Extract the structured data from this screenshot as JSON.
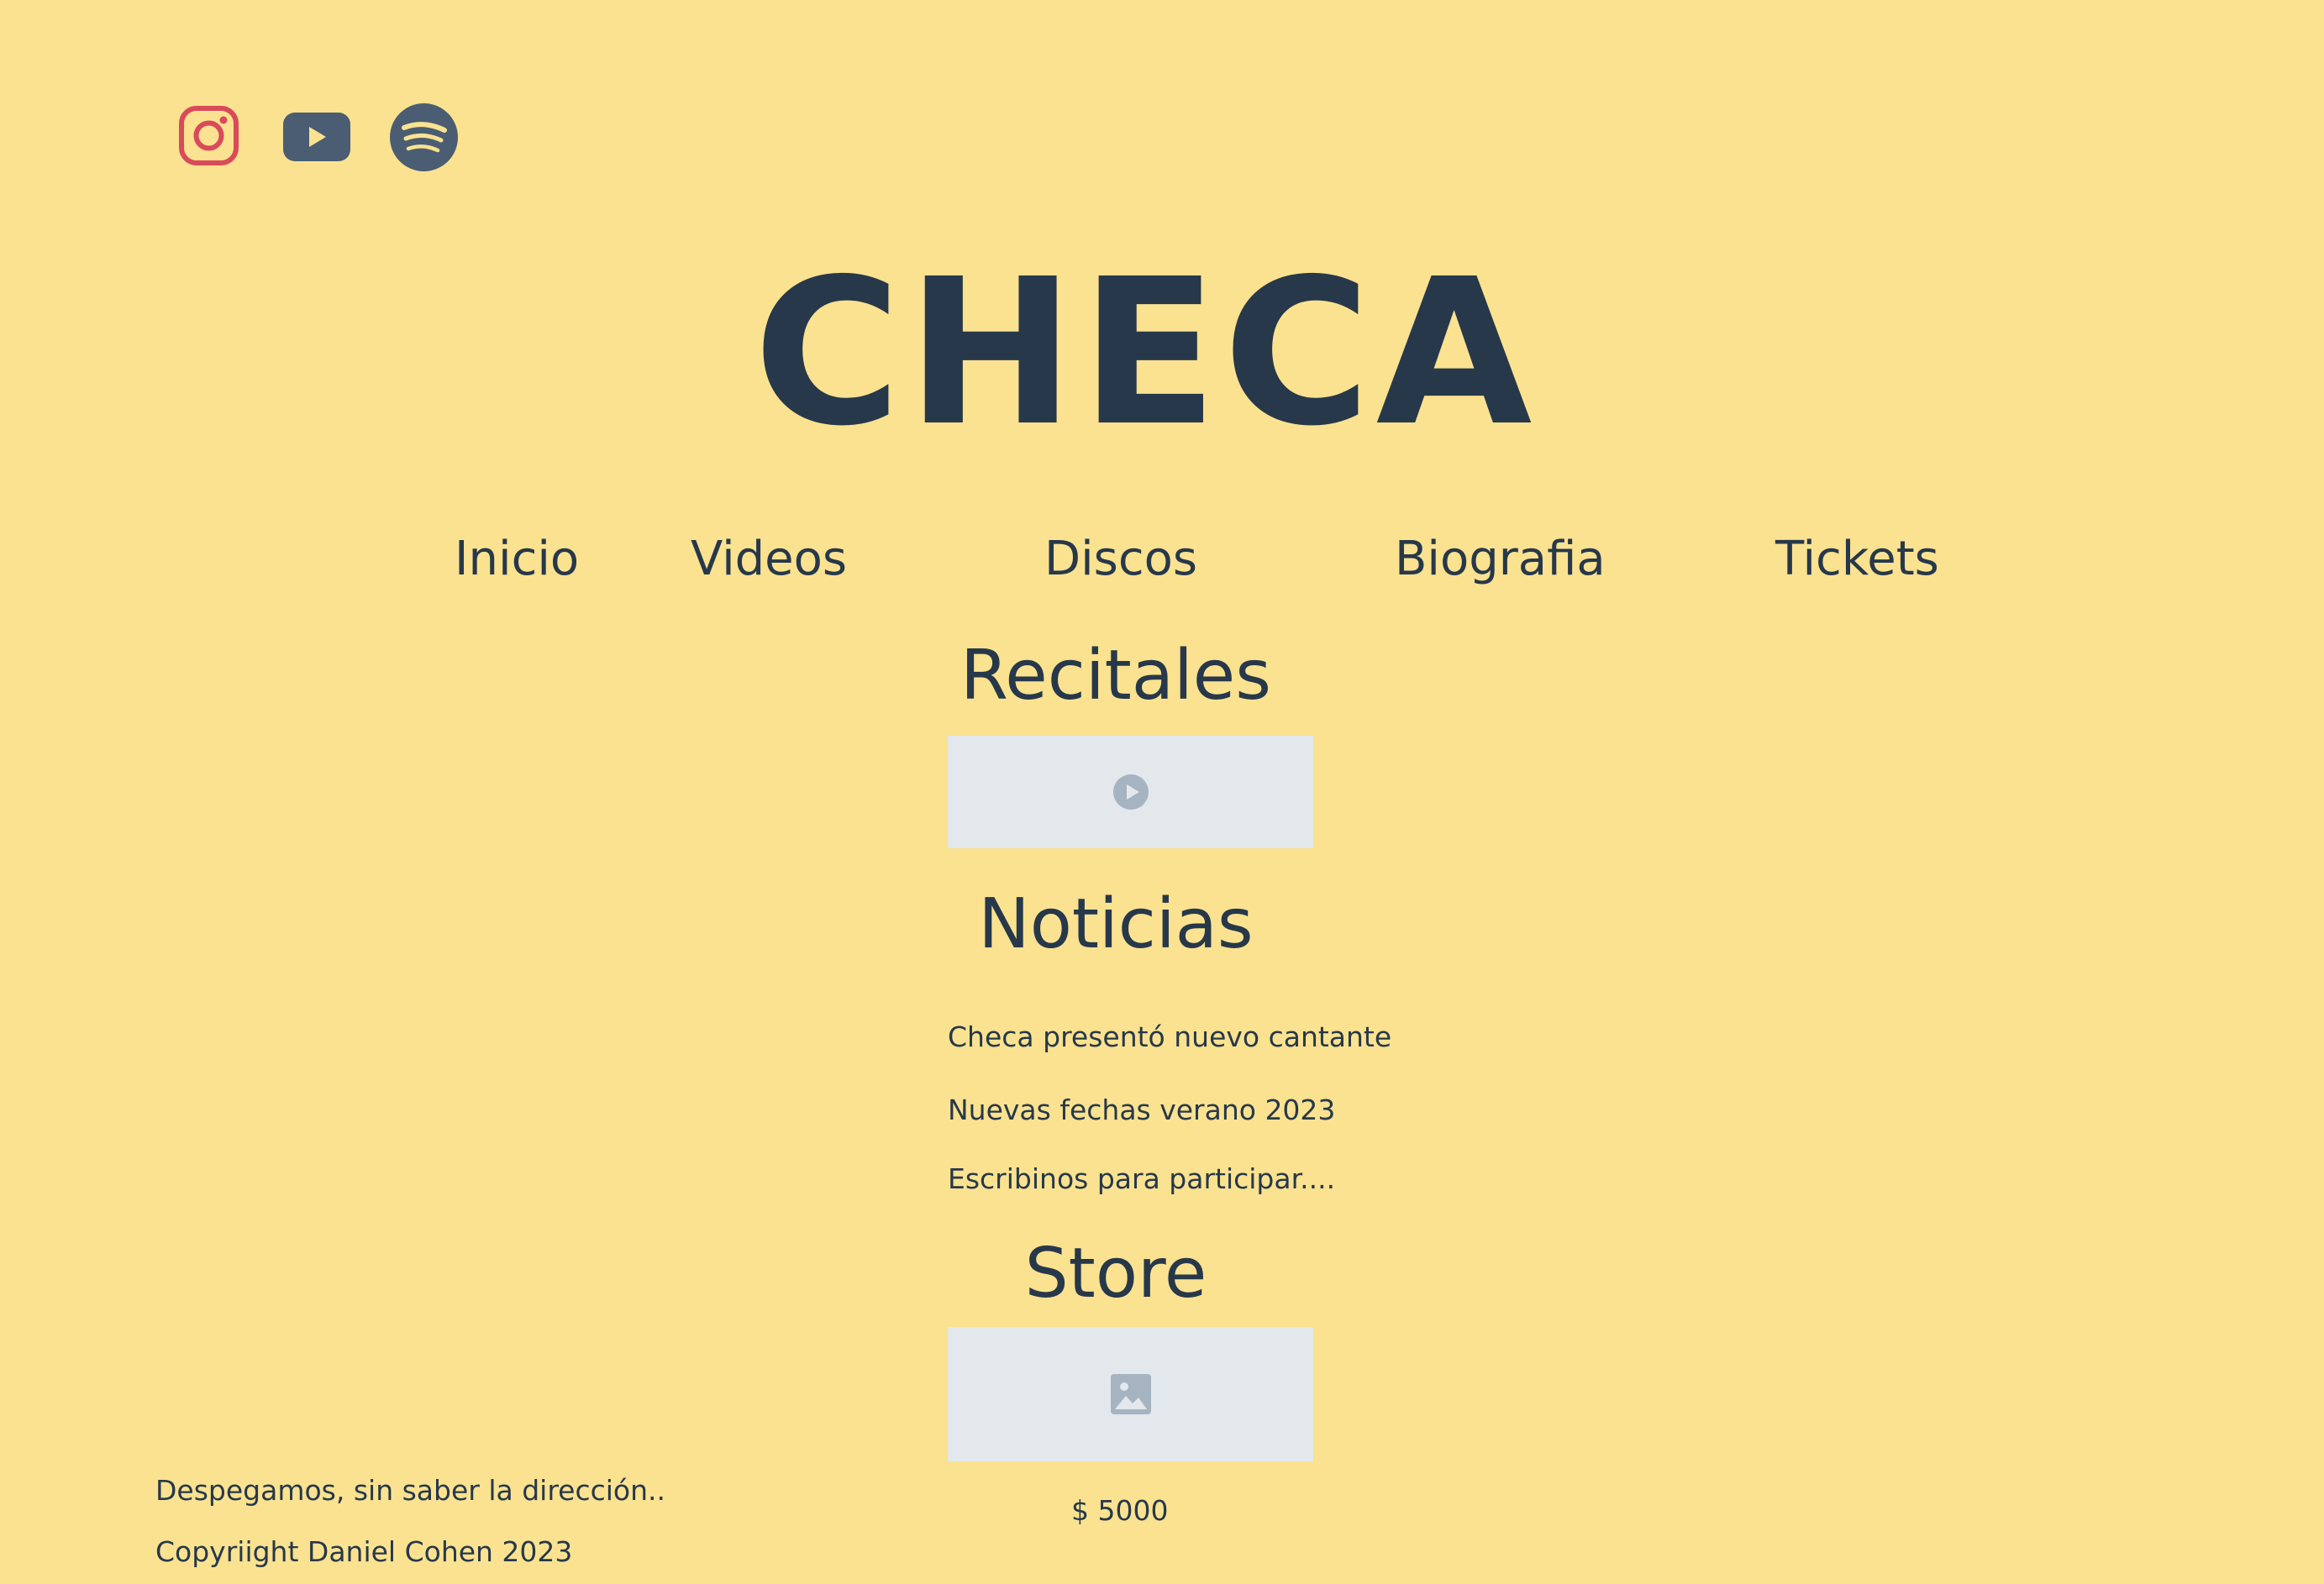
{
  "social": [
    {
      "name": "instagram-icon",
      "color": "#d94a5a"
    },
    {
      "name": "youtube-icon",
      "color": "#4a5d72"
    },
    {
      "name": "spotify-icon",
      "color": "#4a5d72"
    }
  ],
  "header": {
    "title": "CHECA"
  },
  "nav": {
    "items": [
      {
        "label": "Inicio"
      },
      {
        "label": "Videos"
      },
      {
        "label": "Discos"
      },
      {
        "label": "Biografia"
      },
      {
        "label": "Tickets"
      }
    ]
  },
  "recitales": {
    "heading": "Recitales",
    "media_icon": "play-icon"
  },
  "noticias": {
    "heading": "Noticias",
    "items": [
      "Checa presentó nuevo cantante",
      "Nuevas fechas verano 2023",
      "Escribinos para participar...."
    ]
  },
  "store": {
    "heading": "Store",
    "media_icon": "image-icon",
    "price": "$ 5000"
  },
  "footer": {
    "tagline": "Despegamos, sin saber la dirección..",
    "copyright": "Copyriight Daniel Cohen 2023"
  },
  "colors": {
    "background": "#fae290",
    "text": "#27384a",
    "placeholder": "#e3e8ed",
    "placeholder_icon": "#a6b3c0",
    "instagram": "#d94a5a"
  }
}
